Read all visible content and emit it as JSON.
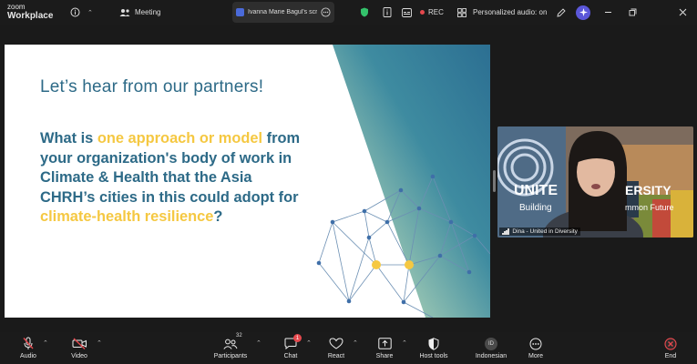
{
  "app": {
    "brand_line1": "zoom",
    "brand_line2": "Workplace"
  },
  "topbar": {
    "meeting_tab": "Meeting",
    "share_tab": "Ivanna Marie Bagul's scr",
    "rec_label": "REC",
    "audio_label": "Personalized audio: on",
    "icons": [
      "info-icon",
      "shield-icon",
      "meeting-info-icon",
      "grid-icon",
      "sparkle-icon",
      "pen-icon",
      "minimize-icon",
      "restore-icon",
      "close-icon"
    ]
  },
  "slide": {
    "title": "Let’s hear from our partners!",
    "q_part1": "What is ",
    "q_hl1": "one approach or model",
    "q_part2": " from your organization's body of work in Climate & Health that the Asia CHRH’s  cities in this could adopt for ",
    "q_hl2": "climate-health resilience",
    "q_part3": "?",
    "colors": {
      "primary": "#2d6a87",
      "highlight": "#f5c842"
    }
  },
  "video": {
    "name_label": "Dina - United in Diversity",
    "banner_text_1": "UNITE",
    "banner_text_2": "ERSITY",
    "banner_text_3": "Building",
    "banner_text_4": "mmon Future"
  },
  "toolbar": {
    "audio": "Audio",
    "video": "Video",
    "participants": "Participants",
    "participants_count": "32",
    "chat": "Chat",
    "chat_badge": "1",
    "react": "React",
    "share": "Share",
    "host_tools": "Host tools",
    "language": "Indonesian",
    "language_code": "ID",
    "more": "More",
    "end": "End"
  }
}
